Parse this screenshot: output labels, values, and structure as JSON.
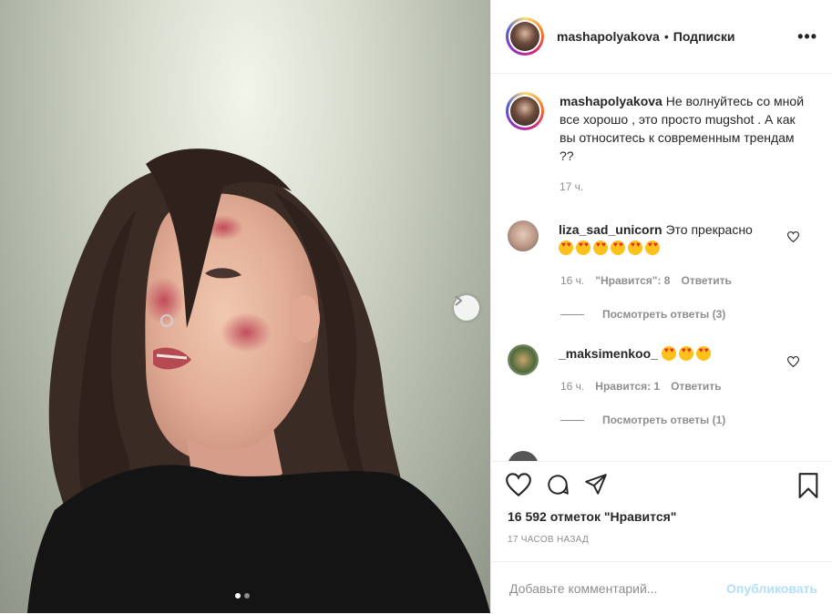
{
  "post": {
    "username": "mashapolyakova",
    "separator": "•",
    "follow_label": "Подписки",
    "more_label": "•••"
  },
  "caption": {
    "username": "mashapolyakova",
    "text": "Не волнуйтесь со мной все хорошо , это просто mugshot . А как вы относитесь к современным трендам ??",
    "time": "17 ч."
  },
  "comments": [
    {
      "username": "liza_sad_unicorn",
      "text": "Это прекрасно",
      "emoji_count": 6,
      "emoji": "heart-eyes-emoji",
      "time": "16 ч.",
      "likes": "\"Нравится\": 8",
      "reply_label": "Ответить",
      "view_replies": "Посмотреть ответы (3)"
    },
    {
      "username": "_maksimenkoo_",
      "text": "",
      "emoji_count": 3,
      "emoji": "heart-eyes-emoji",
      "time": "16 ч.",
      "likes": "Нравится: 1",
      "reply_label": "Ответить",
      "view_replies": "Посмотреть ответы (1)"
    }
  ],
  "actions": {
    "likes_count": "16 592 отметок \"Нравится\"",
    "posted_ago": "17 ЧАСОВ НАЗАД"
  },
  "add_comment": {
    "placeholder": "Добавьте комментарий...",
    "publish_label": "Опубликовать"
  },
  "colors": {
    "text": "#262626",
    "secondary": "#8e8e8e",
    "publish_disabled": "#b2dffc",
    "border": "#efefef"
  },
  "carousel": {
    "slides": 2,
    "active_slide": 1
  }
}
